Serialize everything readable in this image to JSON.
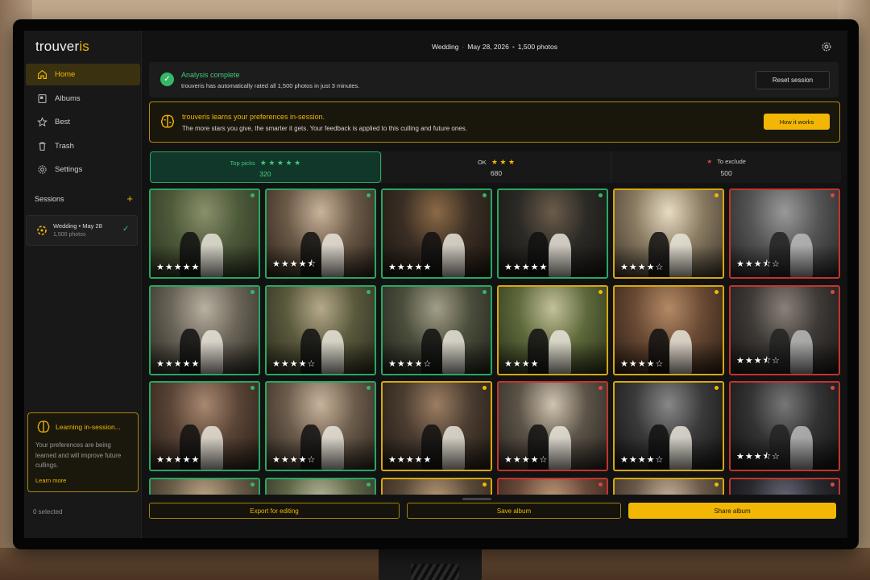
{
  "app": {
    "logo_main": "trouver",
    "logo_accent": "is",
    "nav": [
      {
        "label": "Home",
        "icon": "home-icon"
      },
      {
        "label": "Albums",
        "icon": "album-icon"
      },
      {
        "label": "Best",
        "icon": "star-icon"
      },
      {
        "label": "Trash",
        "icon": "trash-icon"
      },
      {
        "label": "Settings",
        "icon": "gear-icon"
      }
    ],
    "sessions_label": "Sessions",
    "session": {
      "name": "Wedding • May 28",
      "sub": "1,500 photos"
    },
    "learning": {
      "title": "Learning in-session...",
      "text": "Your preferences are being learned and will improve future cullings.",
      "link": "Learn more"
    },
    "selected": "0 selected"
  },
  "topbar": {
    "event": "Wedding",
    "date": "May 28, 2026",
    "count": "1,500 photos"
  },
  "banner": {
    "title": "Analysis complete",
    "text": "trouveris has automatically rated all 1,500 photos in just 3 minutes.",
    "reset": "Reset session"
  },
  "learn_banner": {
    "title": "trouveris learns your preferences in-session.",
    "text": "The more stars you give, the smarter it gets. Your feedback is applied to this culling and future ones.",
    "button": "How it works"
  },
  "filters": {
    "top": {
      "label": "Top picks",
      "stars": "★ ★ ★ ★ ★",
      "count": "320"
    },
    "ok": {
      "label": "OK",
      "stars": "★ ★ ★",
      "count": "680"
    },
    "exclude": {
      "label": "To exclude",
      "stars": "★",
      "count": "500"
    }
  },
  "photos": [
    {
      "status": "top",
      "rating": "★★★★★"
    },
    {
      "status": "top",
      "rating": "★★★★⯪"
    },
    {
      "status": "top",
      "rating": "★★★★★"
    },
    {
      "status": "top",
      "rating": "★★★★★"
    },
    {
      "status": "ok",
      "rating": "★★★★☆"
    },
    {
      "status": "bad",
      "rating": "★★★⯪☆"
    },
    {
      "status": "top",
      "rating": "★★★★★"
    },
    {
      "status": "top",
      "rating": "★★★★☆"
    },
    {
      "status": "top",
      "rating": "★★★★☆"
    },
    {
      "status": "ok",
      "rating": "★★★★"
    },
    {
      "status": "ok",
      "rating": "★★★★☆"
    },
    {
      "status": "bad",
      "rating": "★★★⯪☆"
    },
    {
      "status": "top",
      "rating": "★★★★★"
    },
    {
      "status": "top",
      "rating": "★★★★☆"
    },
    {
      "status": "ok",
      "rating": "★★★★★"
    },
    {
      "status": "bad",
      "rating": "★★★★☆"
    },
    {
      "status": "ok",
      "rating": "★★★★☆"
    },
    {
      "status": "bad",
      "rating": "★★★⯪☆"
    },
    {
      "status": "top",
      "rating": ""
    },
    {
      "status": "top",
      "rating": ""
    },
    {
      "status": "ok",
      "rating": ""
    },
    {
      "status": "bad",
      "rating": ""
    },
    {
      "status": "ok",
      "rating": ""
    },
    {
      "status": "bad",
      "rating": ""
    }
  ],
  "actions": {
    "export": "Export for editing",
    "save": "Save album",
    "share": "Share album"
  },
  "colors": {
    "accent": "#f2b705",
    "top": "#27a764",
    "ok": "#d8a710",
    "exclude": "#c2342e"
  }
}
